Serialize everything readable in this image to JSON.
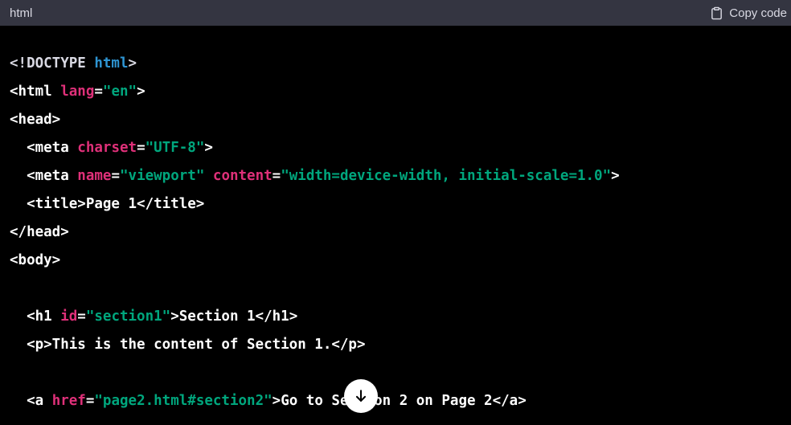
{
  "header": {
    "language": "html",
    "copy_label": "Copy code"
  },
  "code_lines": [
    [
      {
        "t": "<!DOCTYPE ",
        "c": "doctype"
      },
      {
        "t": "html",
        "c": "kw"
      },
      {
        "t": ">",
        "c": "doctype"
      }
    ],
    [
      {
        "t": "<html ",
        "c": "plain"
      },
      {
        "t": "lang",
        "c": "attr"
      },
      {
        "t": "=",
        "c": "plain"
      },
      {
        "t": "\"en\"",
        "c": "str"
      },
      {
        "t": ">",
        "c": "plain"
      }
    ],
    [
      {
        "t": "<head>",
        "c": "plain"
      }
    ],
    [
      {
        "t": "  <meta ",
        "c": "plain"
      },
      {
        "t": "charset",
        "c": "attr"
      },
      {
        "t": "=",
        "c": "plain"
      },
      {
        "t": "\"UTF-8\"",
        "c": "str"
      },
      {
        "t": ">",
        "c": "plain"
      }
    ],
    [
      {
        "t": "  <meta ",
        "c": "plain"
      },
      {
        "t": "name",
        "c": "attr"
      },
      {
        "t": "=",
        "c": "plain"
      },
      {
        "t": "\"viewport\"",
        "c": "str"
      },
      {
        "t": " ",
        "c": "plain"
      },
      {
        "t": "content",
        "c": "attr"
      },
      {
        "t": "=",
        "c": "plain"
      },
      {
        "t": "\"width=device-width, initial-scale=1.0\"",
        "c": "str"
      },
      {
        "t": ">",
        "c": "plain"
      }
    ],
    [
      {
        "t": "  <title>Page 1</title>",
        "c": "plain"
      }
    ],
    [
      {
        "t": "</head>",
        "c": "plain"
      }
    ],
    [
      {
        "t": "<body>",
        "c": "plain"
      }
    ],
    [],
    [
      {
        "t": "  <h1 ",
        "c": "plain"
      },
      {
        "t": "id",
        "c": "attr"
      },
      {
        "t": "=",
        "c": "plain"
      },
      {
        "t": "\"section1\"",
        "c": "str"
      },
      {
        "t": ">Section 1</h1>",
        "c": "plain"
      }
    ],
    [
      {
        "t": "  <p>This is the content of Section 1.</p>",
        "c": "plain"
      }
    ],
    [],
    [
      {
        "t": "  <a ",
        "c": "plain"
      },
      {
        "t": "href",
        "c": "attr"
      },
      {
        "t": "=",
        "c": "plain"
      },
      {
        "t": "\"page2.html#section2\"",
        "c": "str"
      },
      {
        "t": ">Go to Section 2 on Page 2</a>",
        "c": "plain"
      }
    ]
  ],
  "colors": {
    "plain": "#ffffff",
    "doctype": "#d9d9e3",
    "keyword": "#2e95d3",
    "attribute": "#df3079",
    "string": "#00a67d",
    "header_bg": "#343541",
    "code_bg": "#000000"
  },
  "icons": {
    "copy": "clipboard-icon",
    "scroll": "arrow-down-icon"
  }
}
